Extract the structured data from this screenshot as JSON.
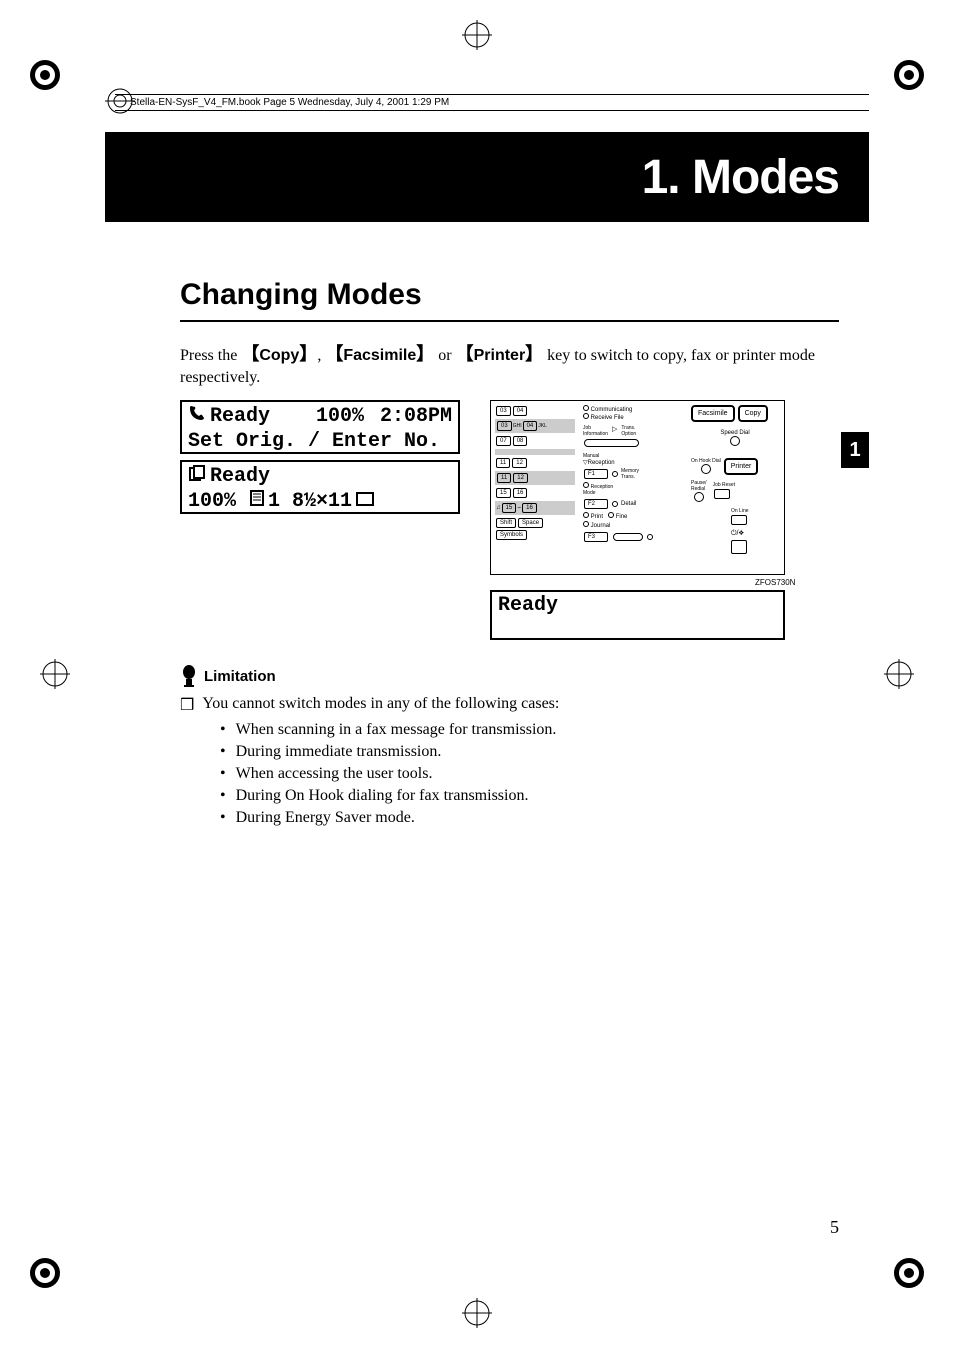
{
  "header_note": "Stella-EN-SysF_V4_FM.book  Page 5  Wednesday, July 4, 2001  1:29 PM",
  "chapter_title": "1. Modes",
  "section_title": "Changing Modes",
  "para1_pre": "Press the ",
  "key1": "Copy",
  "para1_mid1": ", ",
  "key2": "Facsimile",
  "para1_mid2": " or ",
  "key3": "Printer",
  "para1_post": " key to switch to copy, fax or printer mode respectively.",
  "lcd1_line1_a": "Ready",
  "lcd1_line1_b": "100%",
  "lcd1_line1_c": "2:08PM",
  "lcd1_line2": "Set Orig. / Enter No.",
  "lcd2_line1": "Ready",
  "lcd2_line2_a": "100%",
  "lcd2_line2_b": "1",
  "lcd2_line2_c": "8½×11",
  "ready_text": "Ready",
  "diagram_code": "ZFOS730N",
  "ctrl": {
    "communicating": "Communicating",
    "receive_file": "Receive File",
    "facsimile": "Facsimile",
    "copy": "Copy",
    "job_info": "Job\nInformation",
    "trans_option": "Trans.\nOption",
    "speed_dial": "Speed Dial",
    "manual": "Manual",
    "reception": "Reception",
    "memory_trans": "Memory\nTrans.",
    "onhook": "On Hook Dial",
    "printer": "Printer",
    "reception_mode": "Reception\nMode",
    "job_reset": "Job Reset",
    "detail": "Detail",
    "pause_redial": "Pause/\nRedial",
    "online": "On Line",
    "print": "Print",
    "journal": "Journal",
    "fine": "Fine",
    "shift": "Shift",
    "space": "Space",
    "symbols": "Symbols",
    "b03": "03",
    "b04": "04",
    "b07": "07",
    "b08": "08",
    "b11": "11",
    "b12": "12",
    "b15": "15",
    "b16": "16",
    "r03": "03",
    "r04": "04",
    "r11": "11",
    "r12": "12",
    "r15": "15",
    "r16": "16",
    "ghi": "GHI",
    "jkl": "JKL",
    "f1": "F1",
    "f2": "F2",
    "f3": "F3"
  },
  "limitation_label": "Limitation",
  "limitation_intro": "You cannot switch modes in any of the following cases:",
  "bullets": [
    "When scanning in a fax message for transmission.",
    "During immediate transmission.",
    "When accessing the user tools.",
    "During On Hook dialing for fax transmission.",
    "During Energy Saver mode."
  ],
  "page_number": "5",
  "side_tab": "1"
}
